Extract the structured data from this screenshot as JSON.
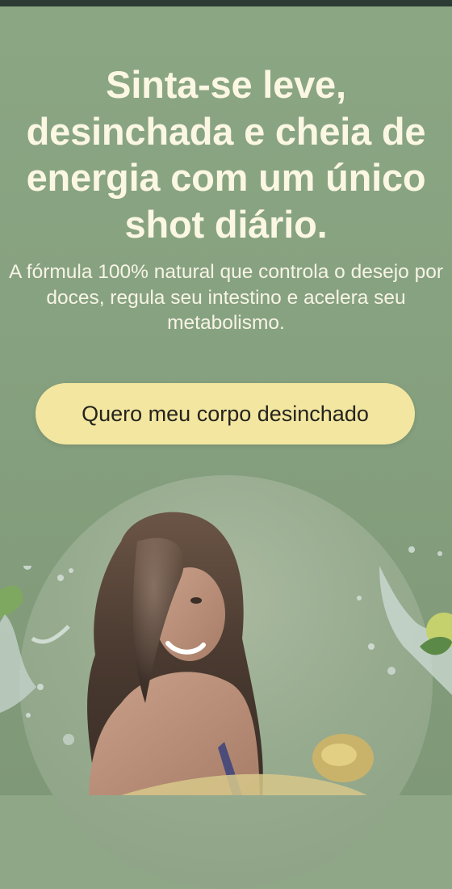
{
  "hero": {
    "headline": "Sinta-se leve, desinchada e cheia de energia com um único shot diário.",
    "subtext": "A fórmula 100% natural que controla o desejo por doces, regula seu intestino e acelera seu metabolismo.",
    "cta_label": "Quero meu corpo desinchado"
  },
  "colors": {
    "background": "#8ba683",
    "top_bar": "#2c3b33",
    "headline_text": "#fbf7e3",
    "cta_background": "#f3e6a0",
    "cta_text": "#24241e"
  },
  "images": {
    "hero_photo": "smiling-woman-photo",
    "left_decoration": "water-splash-with-leaf",
    "right_decoration": "water-splash-with-lime"
  }
}
